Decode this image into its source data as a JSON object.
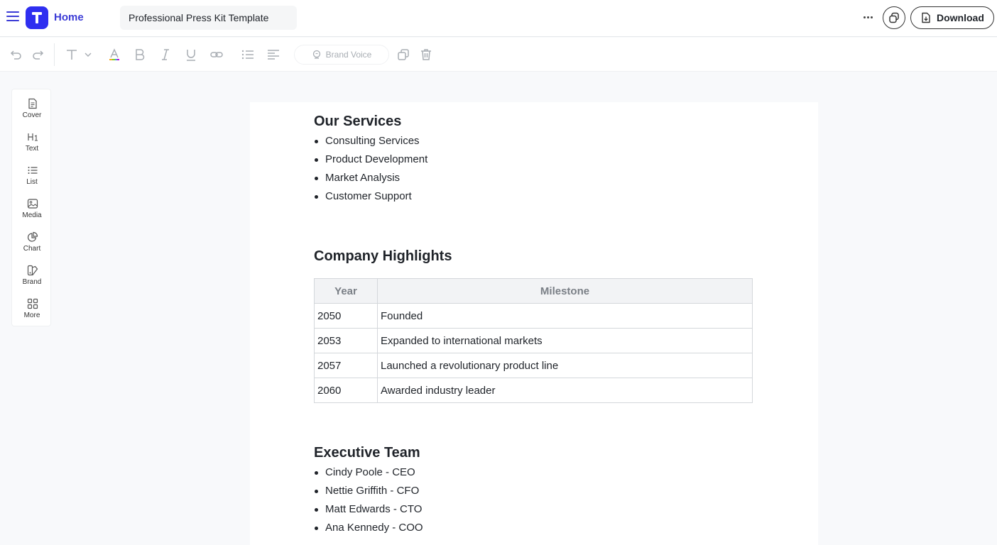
{
  "header": {
    "home_label": "Home",
    "doc_title": "Professional Press Kit Template",
    "download_label": "Download"
  },
  "toolbar": {
    "brand_voice_label": "Brand Voice"
  },
  "side_panel": {
    "items": [
      {
        "label": "Cover",
        "icon": "cover-icon"
      },
      {
        "label": "Text",
        "icon": "heading-icon"
      },
      {
        "label": "List",
        "icon": "list-icon"
      },
      {
        "label": "Media",
        "icon": "image-icon"
      },
      {
        "label": "Chart",
        "icon": "pie-chart-icon"
      },
      {
        "label": "Brand",
        "icon": "brand-icon"
      },
      {
        "label": "More",
        "icon": "grid-icon"
      }
    ]
  },
  "document": {
    "services": {
      "heading": "Our Services",
      "items": [
        "Consulting Services",
        "Product Development",
        "Market Analysis",
        "Customer Support"
      ]
    },
    "highlights": {
      "heading": "Company Highlights",
      "columns": [
        "Year",
        "Milestone"
      ],
      "rows": [
        [
          "2050",
          "Founded"
        ],
        [
          "2053",
          "Expanded to international markets"
        ],
        [
          "2057",
          "Launched a revolutionary product line"
        ],
        [
          "2060",
          "Awarded industry leader"
        ]
      ]
    },
    "team": {
      "heading": "Executive Team",
      "items": [
        "Cindy Poole - CEO",
        "Nettie Griffith - CFO",
        "Matt Edwards - CTO",
        "Ana Kennedy - COO"
      ]
    }
  },
  "colors": {
    "brand": "#2f2ff0",
    "accent_text": "#3b3bd6"
  }
}
